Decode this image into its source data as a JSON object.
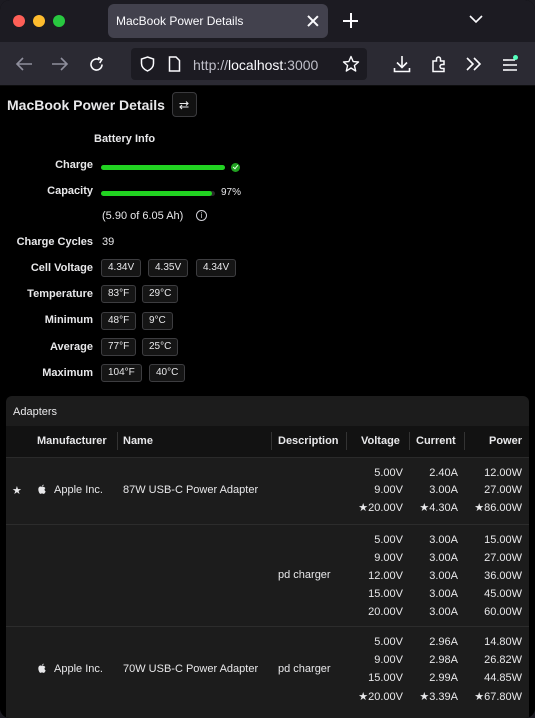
{
  "browser": {
    "tab_title": "MacBook Power Details",
    "url_prefix": "http://",
    "url_host": "localhost",
    "url_port": ":3000"
  },
  "page": {
    "title": "MacBook Power Details"
  },
  "battery": {
    "heading": "Battery Info",
    "charge_label": "Charge",
    "charge_fraction": 1.0,
    "capacity_label": "Capacity",
    "capacity_fraction": 0.97,
    "capacity_percent": "97%",
    "capacity_detail": "(5.90 of 6.05 Ah)",
    "info_glyph": "i",
    "cycles_label": "Charge Cycles",
    "cycles_value": "39",
    "cell_voltage_label": "Cell Voltage",
    "cell_voltages": [
      "4.34V",
      "4.35V",
      "4.34V"
    ],
    "temperature_label": "Temperature",
    "temperature": [
      "83°F",
      "29°C"
    ],
    "minimum_label": "Minimum",
    "minimum": [
      "48°F",
      "9°C"
    ],
    "average_label": "Average",
    "average": [
      "77°F",
      "25°C"
    ],
    "maximum_label": "Maximum",
    "maximum": [
      "104°F",
      "40°C"
    ]
  },
  "adapters": {
    "title": "Adapters",
    "columns": [
      "Manufacturer",
      "Name",
      "Description",
      "Voltage",
      "Current",
      "Power"
    ],
    "star_glyph": "★",
    "rows": [
      {
        "active": true,
        "manufacturer": "Apple Inc.",
        "name": "87W USB-C Power Adapter",
        "description": "",
        "voltage": [
          "5.00V",
          "9.00V",
          "★20.00V"
        ],
        "current": [
          "2.40A",
          "3.00A",
          "★4.30A"
        ],
        "power": [
          "12.00W",
          "27.00W",
          "★86.00W"
        ]
      },
      {
        "active": false,
        "manufacturer": "",
        "name": "",
        "description": "pd charger",
        "voltage": [
          "5.00V",
          "9.00V",
          "12.00V",
          "15.00V",
          "20.00V"
        ],
        "current": [
          "3.00A",
          "3.00A",
          "3.00A",
          "3.00A",
          "3.00A"
        ],
        "power": [
          "15.00W",
          "27.00W",
          "36.00W",
          "45.00W",
          "60.00W"
        ]
      },
      {
        "active": false,
        "manufacturer": "Apple Inc.",
        "name": "70W USB-C Power Adapter",
        "description": "pd charger",
        "voltage": [
          "5.00V",
          "9.00V",
          "15.00V",
          "★20.00V"
        ],
        "current": [
          "2.96A",
          "2.98A",
          "2.99A",
          "★3.39A"
        ],
        "power": [
          "14.80W",
          "26.82W",
          "44.85W",
          "★67.80W"
        ]
      }
    ]
  }
}
